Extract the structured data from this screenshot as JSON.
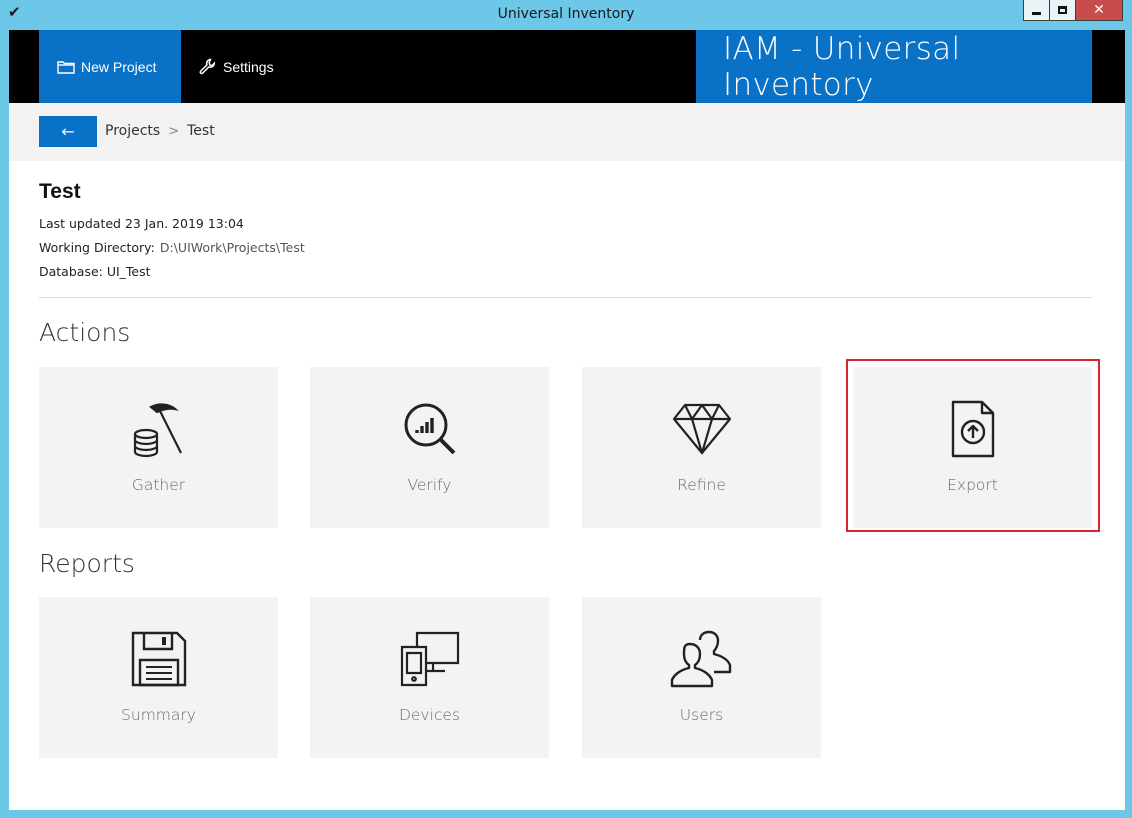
{
  "window": {
    "title": "Universal Inventory"
  },
  "topbar": {
    "new_project_label": "New Project",
    "settings_label": "Settings",
    "brand": "IAM - Universal Inventory"
  },
  "breadcrumb": {
    "back_glyph": "←",
    "items": [
      "Projects",
      "Test"
    ],
    "separator": ">"
  },
  "project": {
    "name": "Test",
    "last_updated": "Last updated 23 Jan. 2019 13:04",
    "working_directory_label": "Working Directory:",
    "working_directory": "D:\\UIWork\\Projects\\Test",
    "database": "Database: UI_Test"
  },
  "actions": {
    "title": "Actions",
    "tiles": [
      {
        "label": "Gather",
        "icon": "pickaxe-coins-icon"
      },
      {
        "label": "Verify",
        "icon": "magnifier-chart-icon"
      },
      {
        "label": "Refine",
        "icon": "diamond-icon"
      },
      {
        "label": "Export",
        "icon": "file-upload-icon"
      }
    ]
  },
  "reports": {
    "title": "Reports",
    "tiles": [
      {
        "label": "Summary",
        "icon": "floppy-disk-icon"
      },
      {
        "label": "Devices",
        "icon": "devices-icon"
      },
      {
        "label": "Users",
        "icon": "users-icon"
      }
    ]
  },
  "colors": {
    "accent": "#0a72c6",
    "titlebar": "#6cc7e8",
    "highlight": "#d9262c",
    "tile": "#f3f3f3"
  }
}
